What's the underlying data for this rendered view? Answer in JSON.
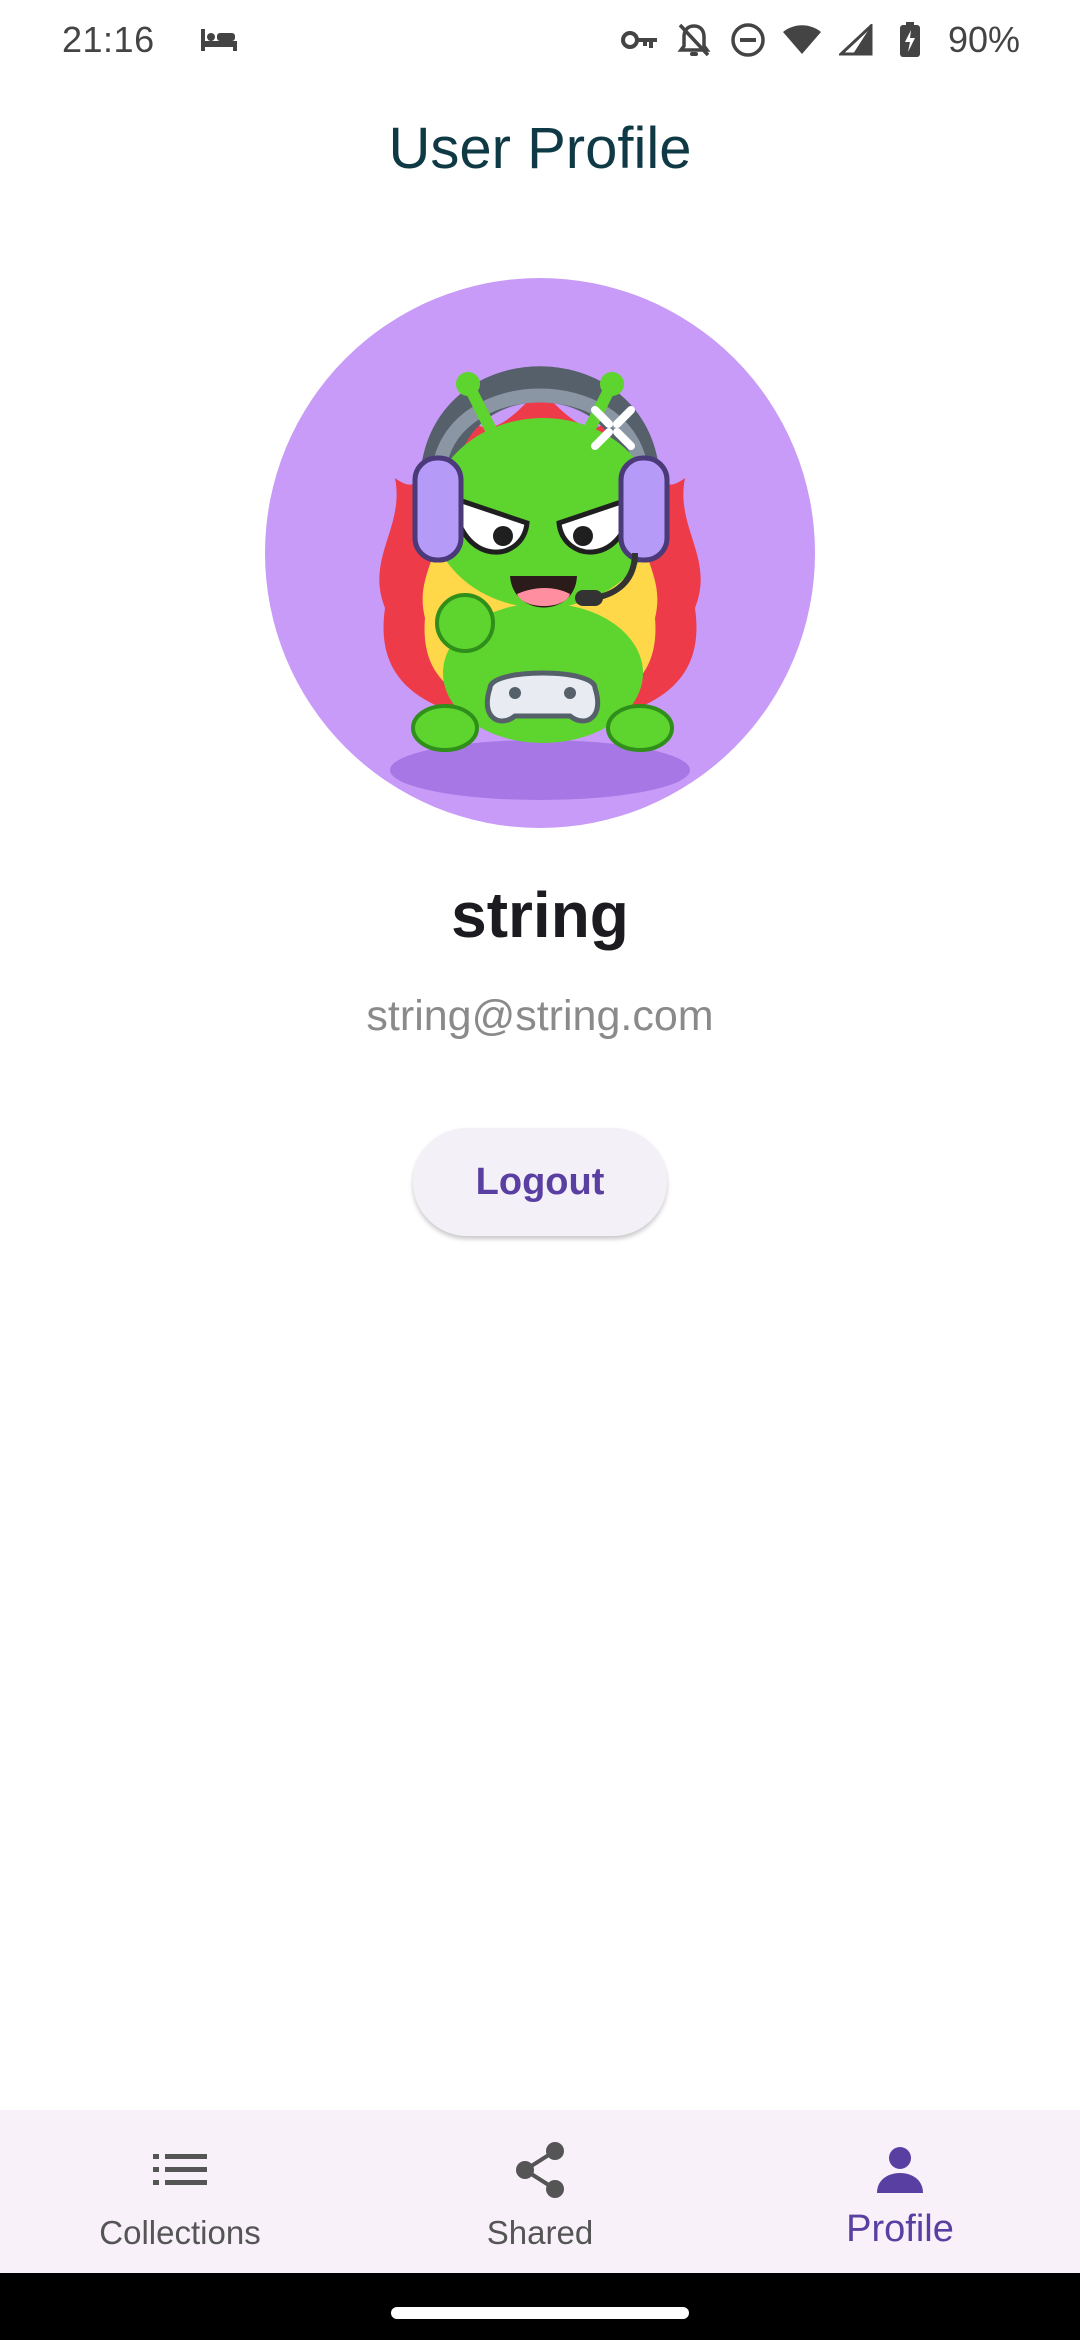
{
  "status_bar": {
    "time": "21:16",
    "battery_percent": "90%",
    "icons": [
      "bed-icon",
      "key-icon",
      "notifications-off-icon",
      "do-not-disturb-icon",
      "wifi-icon",
      "cellular-signal-icon",
      "battery-charging-icon"
    ]
  },
  "header": {
    "title": "User Profile"
  },
  "profile": {
    "avatar_icon": "alien-gamer-avatar",
    "name": "string",
    "email": "string@string.com"
  },
  "actions": {
    "logout_label": "Logout"
  },
  "bottom_nav": {
    "items": [
      {
        "label": "Collections",
        "icon": "list-icon",
        "active": false
      },
      {
        "label": "Shared",
        "icon": "share-icon",
        "active": false
      },
      {
        "label": "Profile",
        "icon": "person-icon",
        "active": true
      }
    ]
  },
  "colors": {
    "accent": "#5a3fa3",
    "title": "#0f3a45",
    "avatar_bg": "#c79bf7",
    "nav_bg": "#f8f1fa",
    "button_bg": "#f4f0f8"
  }
}
